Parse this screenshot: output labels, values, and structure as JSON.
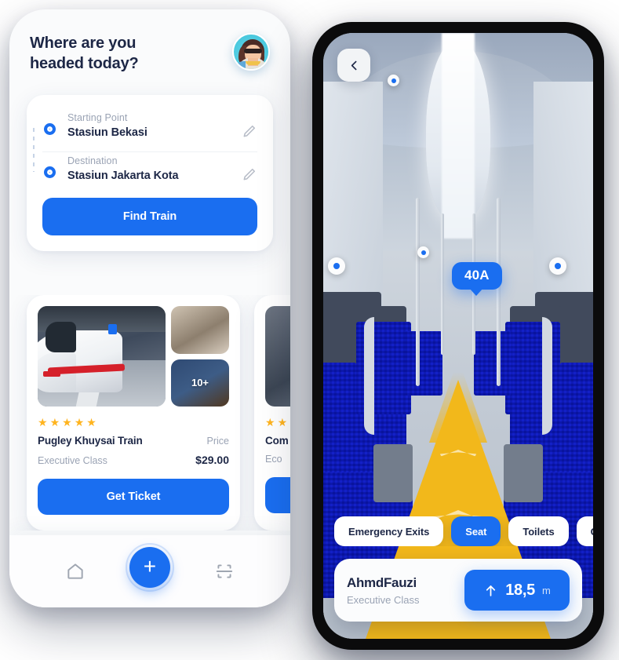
{
  "theme": {
    "accent": "#1a6ef0",
    "ink": "#1d2746",
    "muted": "#9aa3b4",
    "star": "#ffb41f",
    "aisle": "#f2b81b"
  },
  "left_phone": {
    "header": {
      "title": "Where are you\nheaded today?",
      "avatar_name": "user-avatar"
    },
    "route": {
      "start": {
        "label": "Starting Point",
        "value": "Stasiun Bekasi"
      },
      "destination": {
        "label": "Destination",
        "value": "Stasiun Jakarta Kota"
      },
      "find_button": "Find Train"
    },
    "cards": [
      {
        "name": "Pugley Khuysai Train",
        "class": "Executive Class",
        "price_label": "Price",
        "price": "$29.00",
        "stars": 5,
        "more_photos": "10+",
        "button": "Get Ticket"
      },
      {
        "name": "Com",
        "class": "Eco",
        "price_label": "",
        "price": "",
        "stars": 2,
        "more_photos": "",
        "button": ""
      }
    ],
    "nav": {
      "home": "home-icon",
      "add": "plus-icon",
      "scan": "scan-icon"
    }
  },
  "right_phone": {
    "back": "back-chevron",
    "seat_tag": "40A",
    "chips": [
      {
        "label": "Emergency Exits",
        "active": false
      },
      {
        "label": "Seat",
        "active": true
      },
      {
        "label": "Toilets",
        "active": false
      },
      {
        "label": "Gat",
        "active": false
      }
    ],
    "info": {
      "name": "AhmdFauzi",
      "class": "Executive Class",
      "distance": "18,5",
      "unit": "m",
      "direction": "arrow-up"
    }
  }
}
